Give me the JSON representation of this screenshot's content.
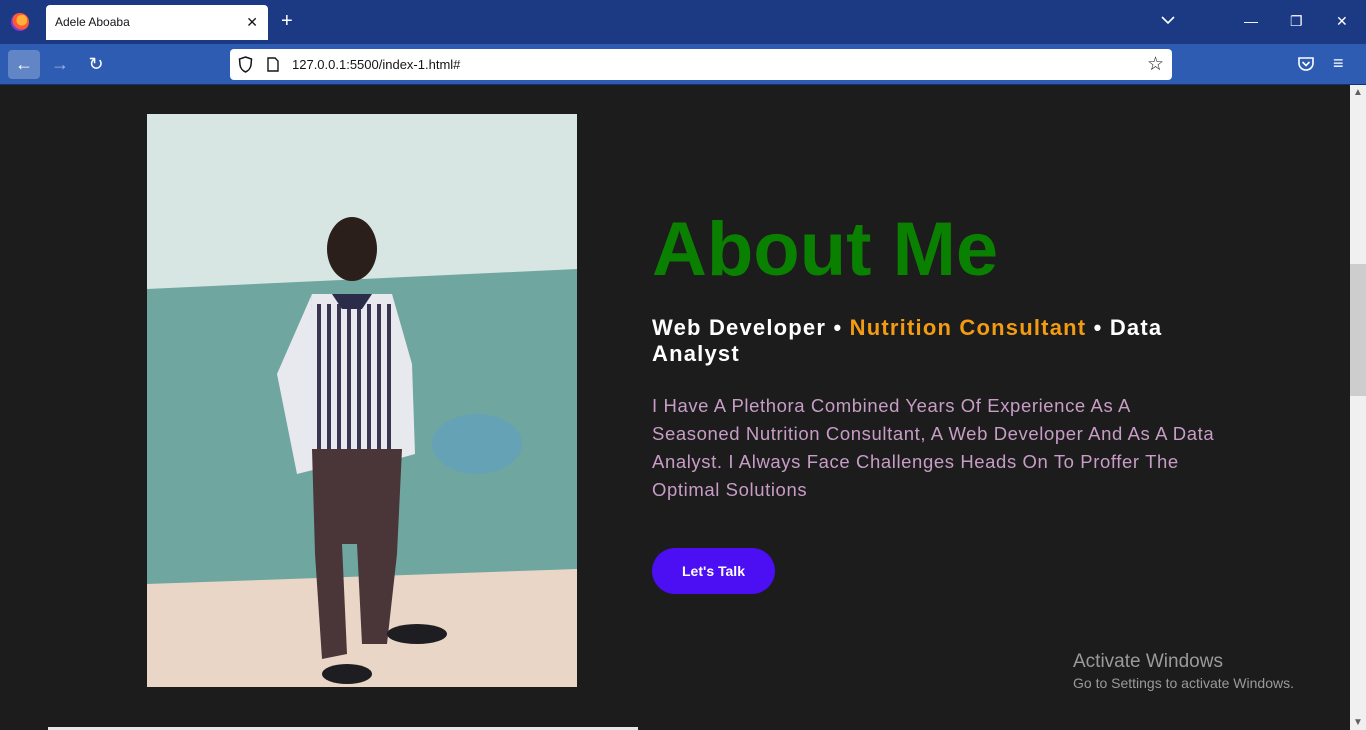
{
  "browser": {
    "tab_title": "Adele Aboaba",
    "tab_close": "✕",
    "new_tab": "+",
    "tab_list": "⌄",
    "url": "127.0.0.1:5500/index-1.html#",
    "star": "☆",
    "menu": "≡",
    "back": "←",
    "forward": "→",
    "reload": "↻",
    "minimize": "—",
    "restore": "❐",
    "close": "✕"
  },
  "page": {
    "heading": "About Me",
    "roles": {
      "part1": "Web Developer • ",
      "highlight": "Nutrition Consultant",
      "part2": " • Data Analyst"
    },
    "description": "I Have A Plethora Combined Years Of Experience As A Seasoned Nutrition Consultant, A Web Developer And As A Data Analyst. I Always Face Challenges Heads On To Proffer The Optimal Solutions",
    "cta_label": "Let's Talk"
  },
  "watermark": {
    "title": "Activate Windows",
    "subtitle": "Go to Settings to activate Windows."
  },
  "colors": {
    "heading": "#0a8000",
    "highlight": "#f39c12",
    "description": "#c79dc6",
    "cta": "#4c0ef2",
    "background": "#1c1c1c",
    "tabbar": "#1b3a83",
    "navbar": "#2e5cb3"
  }
}
